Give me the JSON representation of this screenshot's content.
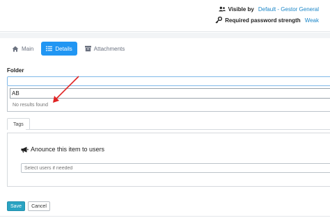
{
  "header": {
    "visible_by_label": "Visible by",
    "visible_by_value": "Default - Gestor General",
    "password_label": "Required password strength",
    "password_value": "Weak"
  },
  "tabs": [
    {
      "label": "Main",
      "icon": "home-icon",
      "active": false
    },
    {
      "label": "Details",
      "icon": "list-icon",
      "active": true
    },
    {
      "label": "Attachments",
      "icon": "attachment-icon",
      "active": false
    }
  ],
  "folder": {
    "label": "Folder",
    "search_value": "AB",
    "no_results": "No results found"
  },
  "tags_tab": "Tags",
  "announce": {
    "title": "Anounce this item to users",
    "placeholder": "Select users if needed"
  },
  "buttons": {
    "save": "Save",
    "cancel": "Cancel"
  },
  "colors": {
    "accent": "#2196f3",
    "save": "#2aa3c2",
    "link": "#1a86c8",
    "annotation": "#e02424"
  }
}
